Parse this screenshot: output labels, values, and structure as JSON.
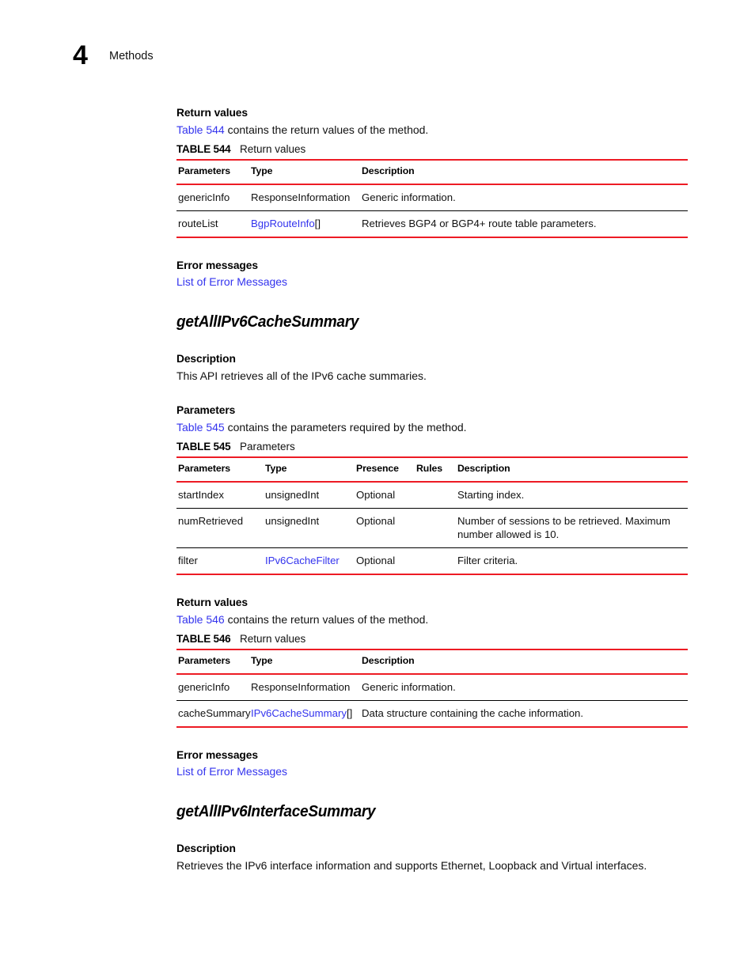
{
  "running_header": {
    "chapter_number": "4",
    "chapter_title": "Methods"
  },
  "sections": {
    "bgp_return": {
      "heading": "Return values",
      "intro_link": "Table 544",
      "intro_rest": " contains the return values of the method.",
      "table": {
        "number": "TABLE 544",
        "title": "Return values",
        "columns": [
          "Parameters",
          "Type",
          "Description"
        ],
        "rows": [
          {
            "parameter": "genericInfo",
            "type": "ResponseInformation",
            "type_link": "",
            "type_suffix": "",
            "description": "Generic information."
          },
          {
            "parameter": "routeList",
            "type": "",
            "type_link": "BgpRouteInfo",
            "type_suffix": "[]",
            "description": "Retrieves BGP4 or BGP4+ route table parameters."
          }
        ]
      }
    },
    "bgp_errors": {
      "heading": "Error messages",
      "link": "List of Error Messages"
    },
    "cache_summary": {
      "method_name": "getAllIPv6CacheSummary",
      "description_heading": "Description",
      "description_text": "This API retrieves all of the IPv6 cache summaries.",
      "parameters_heading": "Parameters",
      "parameters_intro_link": "Table 545",
      "parameters_intro_rest": " contains the parameters required by the method.",
      "parameters_table": {
        "number": "TABLE 545",
        "title": "Parameters",
        "columns": [
          "Parameters",
          "Type",
          "Presence",
          "Rules",
          "Description"
        ],
        "rows": [
          {
            "parameter": "startIndex",
            "type": "unsignedInt",
            "type_link": "",
            "presence": "Optional",
            "rules": "",
            "description": "Starting index."
          },
          {
            "parameter": "numRetrieved",
            "type": "unsignedInt",
            "type_link": "",
            "presence": "Optional",
            "rules": "",
            "description": "Number of sessions to be retrieved. Maximum number allowed is 10."
          },
          {
            "parameter": "filter",
            "type": "",
            "type_link": "IPv6CacheFilter",
            "presence": "Optional",
            "rules": "",
            "description": "Filter criteria."
          }
        ]
      },
      "return_heading": "Return values",
      "return_intro_link": "Table 546",
      "return_intro_rest": " contains the return values of the method.",
      "return_table": {
        "number": "TABLE 546",
        "title": "Return values",
        "columns": [
          "Parameters",
          "Type",
          "Description"
        ],
        "rows": [
          {
            "parameter": "genericInfo",
            "type": "ResponseInformation",
            "type_link": "",
            "type_suffix": "",
            "description": "Generic information."
          },
          {
            "parameter": "cacheSummary",
            "type": "",
            "type_link": "IPv6CacheSummary",
            "type_suffix": "[]",
            "description": "Data structure containing the cache information."
          }
        ]
      },
      "errors_heading": "Error messages",
      "errors_link": "List of Error Messages"
    },
    "interface_summary": {
      "method_name": "getAllIPv6InterfaceSummary",
      "description_heading": "Description",
      "description_text": "Retrieves the IPv6 interface information and supports Ethernet, Loopback and Virtual interfaces."
    }
  },
  "colors": {
    "rule_red": "#ed1b24",
    "link_blue": "#3333ee",
    "text_black": "#111111"
  }
}
